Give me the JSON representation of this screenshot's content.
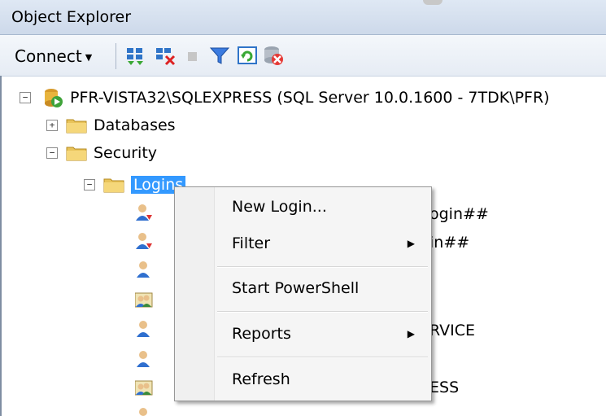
{
  "window": {
    "title": "Object Explorer"
  },
  "toolbar": {
    "connect_label": "Connect"
  },
  "tree": {
    "server": {
      "label": "PFR-VISTA32\\SQLEXPRESS (SQL Server 10.0.1600 - 7TDK\\PFR)",
      "expander": "−"
    },
    "databases": {
      "label": "Databases",
      "expander": "+"
    },
    "security": {
      "label": "Security",
      "expander": "−"
    },
    "logins": {
      "label": "Logins",
      "expander": "−"
    },
    "visible_fragments": {
      "row1": "ogin##",
      "row2": "in##",
      "row5": "RVICE",
      "row7": "ESS"
    }
  },
  "context_menu": {
    "items": [
      {
        "label": "New Login..."
      },
      {
        "label": "Filter",
        "submenu_arrow": "▶"
      },
      {
        "label": "Start PowerShell"
      },
      {
        "label": "Reports",
        "submenu_arrow": "▶"
      },
      {
        "label": "Refresh"
      }
    ]
  },
  "colors": {
    "selection": "#3399ff",
    "title_bar": "#cdd9ea",
    "folder": "#e8c35a"
  }
}
